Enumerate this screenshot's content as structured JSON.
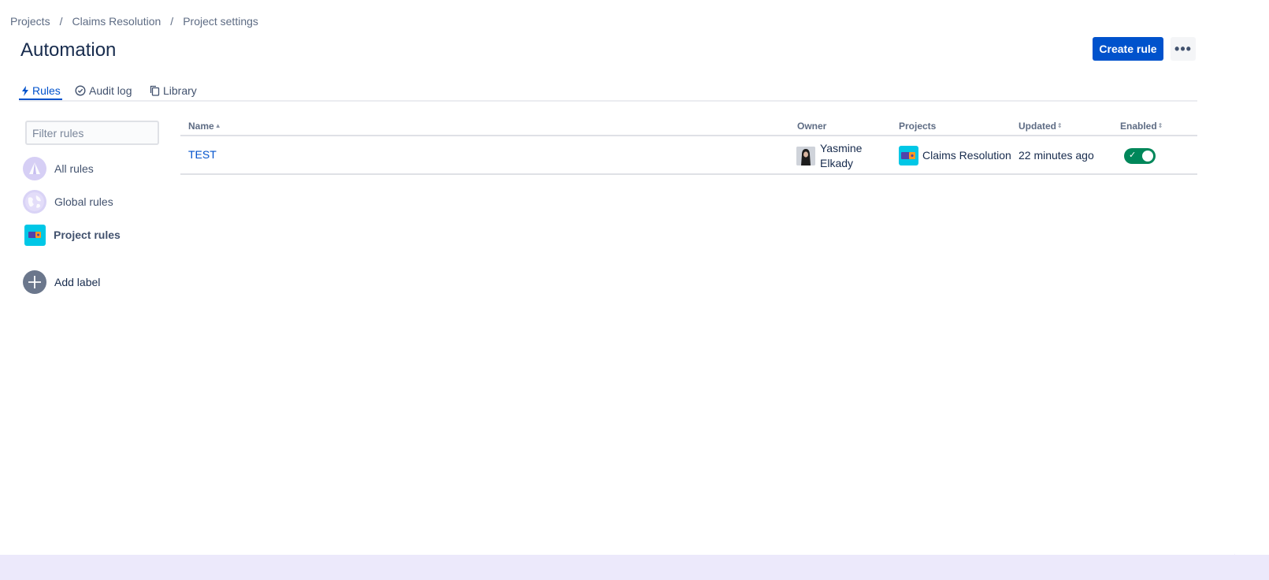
{
  "breadcrumb": {
    "items": [
      "Projects",
      "Claims Resolution",
      "Project settings"
    ],
    "separator": "/"
  },
  "header": {
    "title": "Automation",
    "create_label": "Create rule",
    "more_label": "•••"
  },
  "tabs": [
    {
      "label": "Rules",
      "icon": "lightning-icon",
      "active": true
    },
    {
      "label": "Audit log",
      "icon": "check-circle-icon",
      "active": false
    },
    {
      "label": "Library",
      "icon": "copy-icon",
      "active": false
    }
  ],
  "sidebar": {
    "filter_placeholder": "Filter rules",
    "items": [
      {
        "label": "All rules",
        "icon": "atlassian-icon"
      },
      {
        "label": "Global rules",
        "icon": "globe-icon"
      },
      {
        "label": "Project rules",
        "icon": "project-icon"
      }
    ],
    "add_label": "Add label"
  },
  "table": {
    "columns": {
      "name": "Name",
      "owner": "Owner",
      "projects": "Projects",
      "updated": "Updated",
      "enabled": "Enabled"
    },
    "rows": [
      {
        "name": "TEST",
        "owner_first": "Yasmine",
        "owner_last": "Elkady",
        "project": "Claims Resolution",
        "updated": "22 minutes ago",
        "enabled": true
      }
    ]
  },
  "colors": {
    "primary": "#0052cc",
    "enabled": "#00875a",
    "project_icon": "#00c7e6",
    "frame": "#ece9fb"
  }
}
